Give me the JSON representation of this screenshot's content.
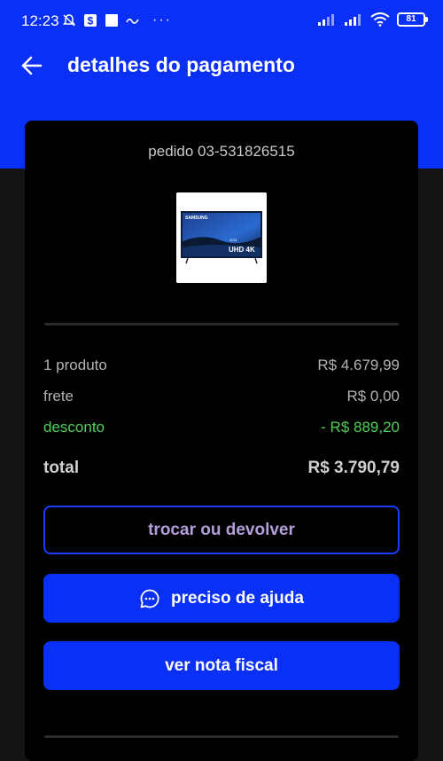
{
  "status_bar": {
    "time": "12:23",
    "battery": "81",
    "left_icons": [
      "mute-bell-icon",
      "dollar-app-icon",
      "square-app-icon",
      "mini-app-icon"
    ],
    "right_icons": [
      "signal-icon",
      "signal-icon",
      "wifi-icon",
      "battery-icon"
    ],
    "more_dots": "···"
  },
  "header": {
    "title": "detalhes do pagamento",
    "back_icon": "arrow-left-icon",
    "background": "#0a2ff5"
  },
  "order": {
    "label": "pedido 03-531826515",
    "thumbnail": {
      "brand": "SAMSUNG",
      "badge": "UHD 4K",
      "year": "2021"
    }
  },
  "summary": {
    "products": {
      "label": "1 produto",
      "value": "R$ 4.679,99"
    },
    "shipping": {
      "label": "frete",
      "value": "R$ 0,00"
    },
    "discount": {
      "label": "desconto",
      "value": "- R$ 889,20",
      "color": "#4fd156"
    },
    "total": {
      "label": "total",
      "value": "R$ 3.790,79"
    }
  },
  "actions": {
    "return_label": "trocar ou devolver",
    "help_label": "preciso de ajuda",
    "help_icon": "chat-bubble-icon",
    "invoice_label": "ver nota fiscal",
    "accent": "#0a2ff5"
  }
}
